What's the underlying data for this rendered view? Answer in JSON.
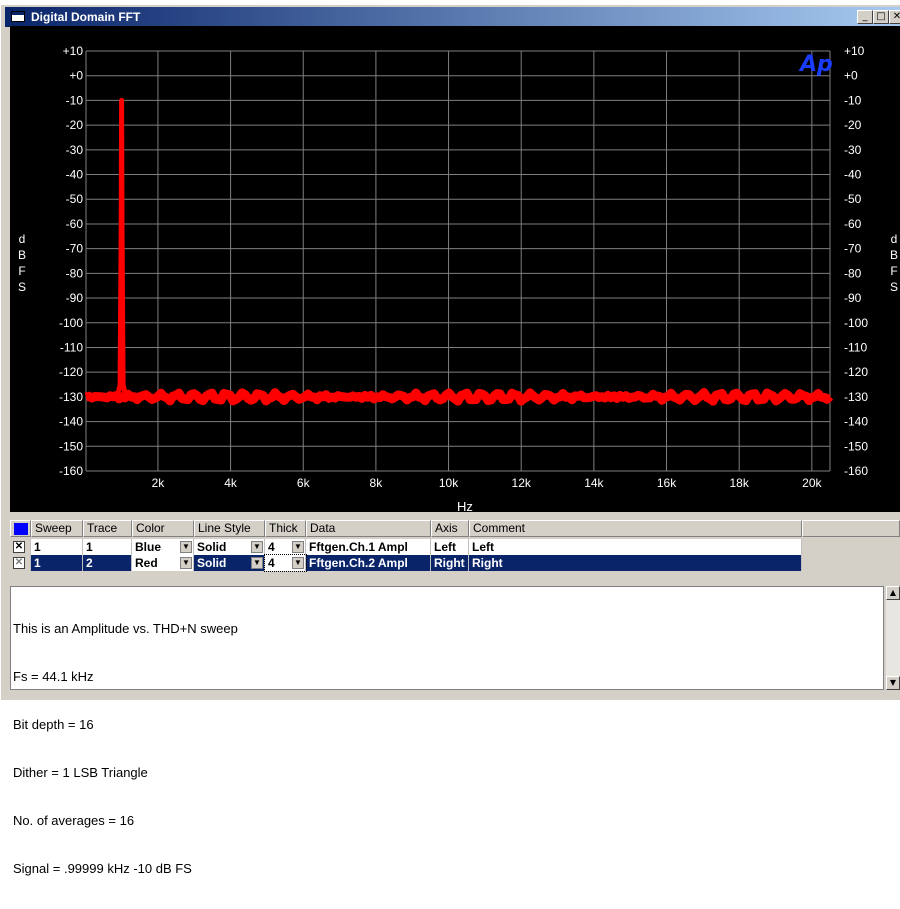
{
  "window": {
    "title": "Digital Domain FFT"
  },
  "title_buttons": {
    "minimize": "_",
    "maximize": "□",
    "close": "✕"
  },
  "graph": {
    "logo": "Ap",
    "y_label_left": [
      "d",
      "B",
      "F",
      "S"
    ],
    "y_label_right": [
      "d",
      "B",
      "F",
      "S"
    ],
    "x_label": "Hz",
    "y_ticks": [
      "+10",
      "+0",
      "-10",
      "-20",
      "-30",
      "-40",
      "-50",
      "-60",
      "-70",
      "-80",
      "-90",
      "-100",
      "-110",
      "-120",
      "-130",
      "-140",
      "-150",
      "-160"
    ],
    "x_ticks": [
      "2k",
      "4k",
      "6k",
      "8k",
      "10k",
      "12k",
      "14k",
      "16k",
      "18k",
      "20k"
    ],
    "trace_color": "#ff0000",
    "background": "#000000"
  },
  "chart_data": {
    "type": "line",
    "xlabel": "Hz",
    "ylabel": "dBFS",
    "xlim": [
      20,
      20500
    ],
    "ylim": [
      -160,
      10
    ],
    "grid": true,
    "series": [
      {
        "name": "Fftgen.Ch.2 Ampl",
        "color": "#ff0000",
        "x": [
          20,
          500,
          900,
          960,
          990,
          1000,
          1010,
          1040,
          1100,
          2000,
          4000,
          6000,
          8000,
          10000,
          12000,
          14000,
          16000,
          18000,
          20000,
          20500
        ],
        "y": [
          -130,
          -130,
          -129,
          -125,
          -60,
          -10,
          -60,
          -125,
          -129,
          -130,
          -130,
          -130,
          -130,
          -130,
          -130,
          -130,
          -130,
          -130,
          -130,
          -130
        ]
      }
    ]
  },
  "legend_table": {
    "headers": [
      "Sweep",
      "Trace",
      "Color",
      "Line Style",
      "Thick",
      "Data",
      "Axis",
      "Comment"
    ],
    "rows": [
      {
        "sweep": "1",
        "trace": "1",
        "color": "Blue",
        "style": "Solid",
        "thick": "4",
        "data": "Fftgen.Ch.1 Ampl",
        "axis": "Left",
        "comment": "Left"
      },
      {
        "sweep": "1",
        "trace": "2",
        "color": "Red",
        "style": "Solid",
        "thick": "4",
        "data": "Fftgen.Ch.2 Ampl",
        "axis": "Right",
        "comment": "Right"
      }
    ]
  },
  "comment_text": [
    "This is an Amplitude vs. THD+N sweep",
    "Fs = 44.1 kHz",
    "Bit depth = 16",
    "Dither = 1 LSB Triangle",
    "No. of averages = 16",
    "Signal = .99999 kHz -10 dB FS"
  ]
}
